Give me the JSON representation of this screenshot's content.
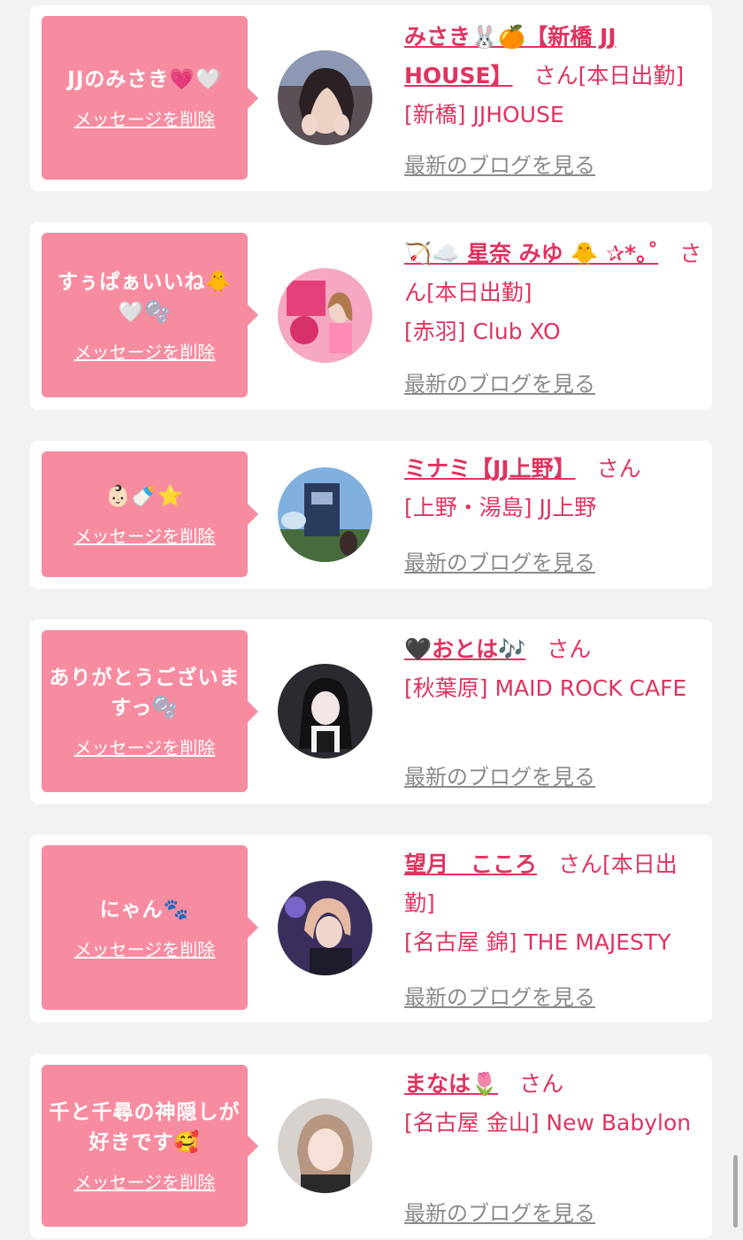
{
  "colors": {
    "bubble": "#f78ca0",
    "accent": "#e0335f",
    "muted": "#8a8a8a",
    "background": "#f2f2f2"
  },
  "cards": [
    {
      "message": "JJのみさき💗🤍",
      "delete_label": "メッセージを削除",
      "name": "みさき🐰🍊【新橋 JJ HOUSE】",
      "honorific": "さん",
      "status": "[本日出勤]",
      "shop": "[新橋] JJHOUSE",
      "blog_label": "最新のブログを見る",
      "avatar": "photo-woman-hands-on-cheeks"
    },
    {
      "message": "すぅぱぁいいね🐥🤍🫧",
      "delete_label": "メッセージを削除",
      "name": "🏹☁️ 星奈 みゆ 🐥 ✰*｡˚",
      "honorific": "さん",
      "status": "[本日出勤]",
      "shop": "[赤羽] Club XO",
      "blog_label": "最新のブログを見る",
      "avatar": "photo-pink-room"
    },
    {
      "message": "👶🏻🍼⭐️",
      "delete_label": "メッセージを削除",
      "name": "ミナミ【JJ上野】",
      "honorific": "さん",
      "status": "",
      "shop": "[上野・湯島] JJ上野",
      "blog_label": "最新のブログを見る",
      "avatar": "photo-outdoor-sign"
    },
    {
      "message": "ありがとうございますっ🫧",
      "delete_label": "メッセージを削除",
      "name": "🖤おとは🎶",
      "honorific": "さん",
      "status": "",
      "shop": "[秋葉原] MAID ROCK CAFE",
      "blog_label": "最新のブログを見る",
      "avatar": "photo-dark-hair-girl"
    },
    {
      "message": "にゃん🐾",
      "delete_label": "メッセージを削除",
      "name": "望月　こころ",
      "honorific": "さん",
      "status": "[本日出勤]",
      "shop": "[名古屋 錦] THE MAJESTY",
      "blog_label": "最新のブログを見る",
      "avatar": "photo-purple-light"
    },
    {
      "message": "千と千尋の神隠しが好きです🥰",
      "delete_label": "メッセージを削除",
      "name": "まなは🌷",
      "honorific": "さん",
      "status": "",
      "shop": "[名古屋 金山] New Babylon",
      "blog_label": "最新のブログを見る",
      "avatar": "photo-light-hair-woman"
    }
  ]
}
